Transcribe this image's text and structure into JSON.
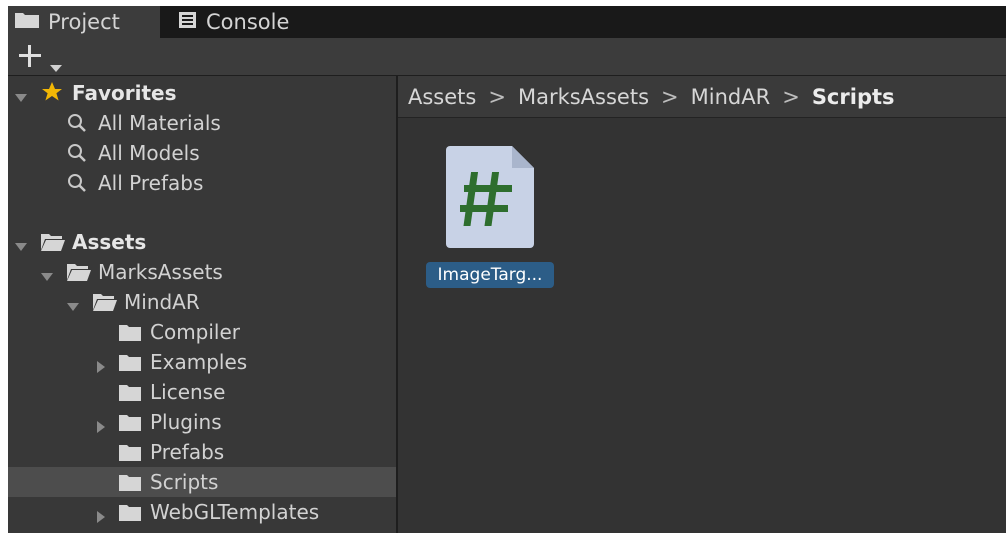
{
  "tabs": [
    {
      "label": "Project",
      "icon": "folder-icon",
      "active": true
    },
    {
      "label": "Console",
      "icon": "console-icon",
      "active": false
    }
  ],
  "toolbar": {
    "create_icon": "plus-icon",
    "dropdown_icon": "caret-down-icon"
  },
  "favorites": {
    "label": "Favorites",
    "items": [
      {
        "label": "All Materials",
        "icon": "search-icon"
      },
      {
        "label": "All Models",
        "icon": "search-icon"
      },
      {
        "label": "All Prefabs",
        "icon": "search-icon"
      }
    ]
  },
  "tree": {
    "assets_label": "Assets",
    "marks_label": "MarksAssets",
    "mindar_label": "MindAR",
    "children": [
      {
        "label": "Compiler",
        "expandable": false
      },
      {
        "label": "Examples",
        "expandable": true
      },
      {
        "label": "License",
        "expandable": false
      },
      {
        "label": "Plugins",
        "expandable": true
      },
      {
        "label": "Prefabs",
        "expandable": false
      },
      {
        "label": "Scripts",
        "expandable": false,
        "selected": true
      },
      {
        "label": "WebGLTemplates",
        "expandable": true
      }
    ]
  },
  "breadcrumb": [
    "Assets",
    "MarksAssets",
    "MindAR",
    "Scripts"
  ],
  "assets": [
    {
      "label": "ImageTarg...",
      "icon": "csharp-script-icon",
      "selected": true
    }
  ],
  "colors": {
    "selection": "#2c5d87",
    "script_glyph": "#2e6e2e",
    "panel": "#383838"
  }
}
